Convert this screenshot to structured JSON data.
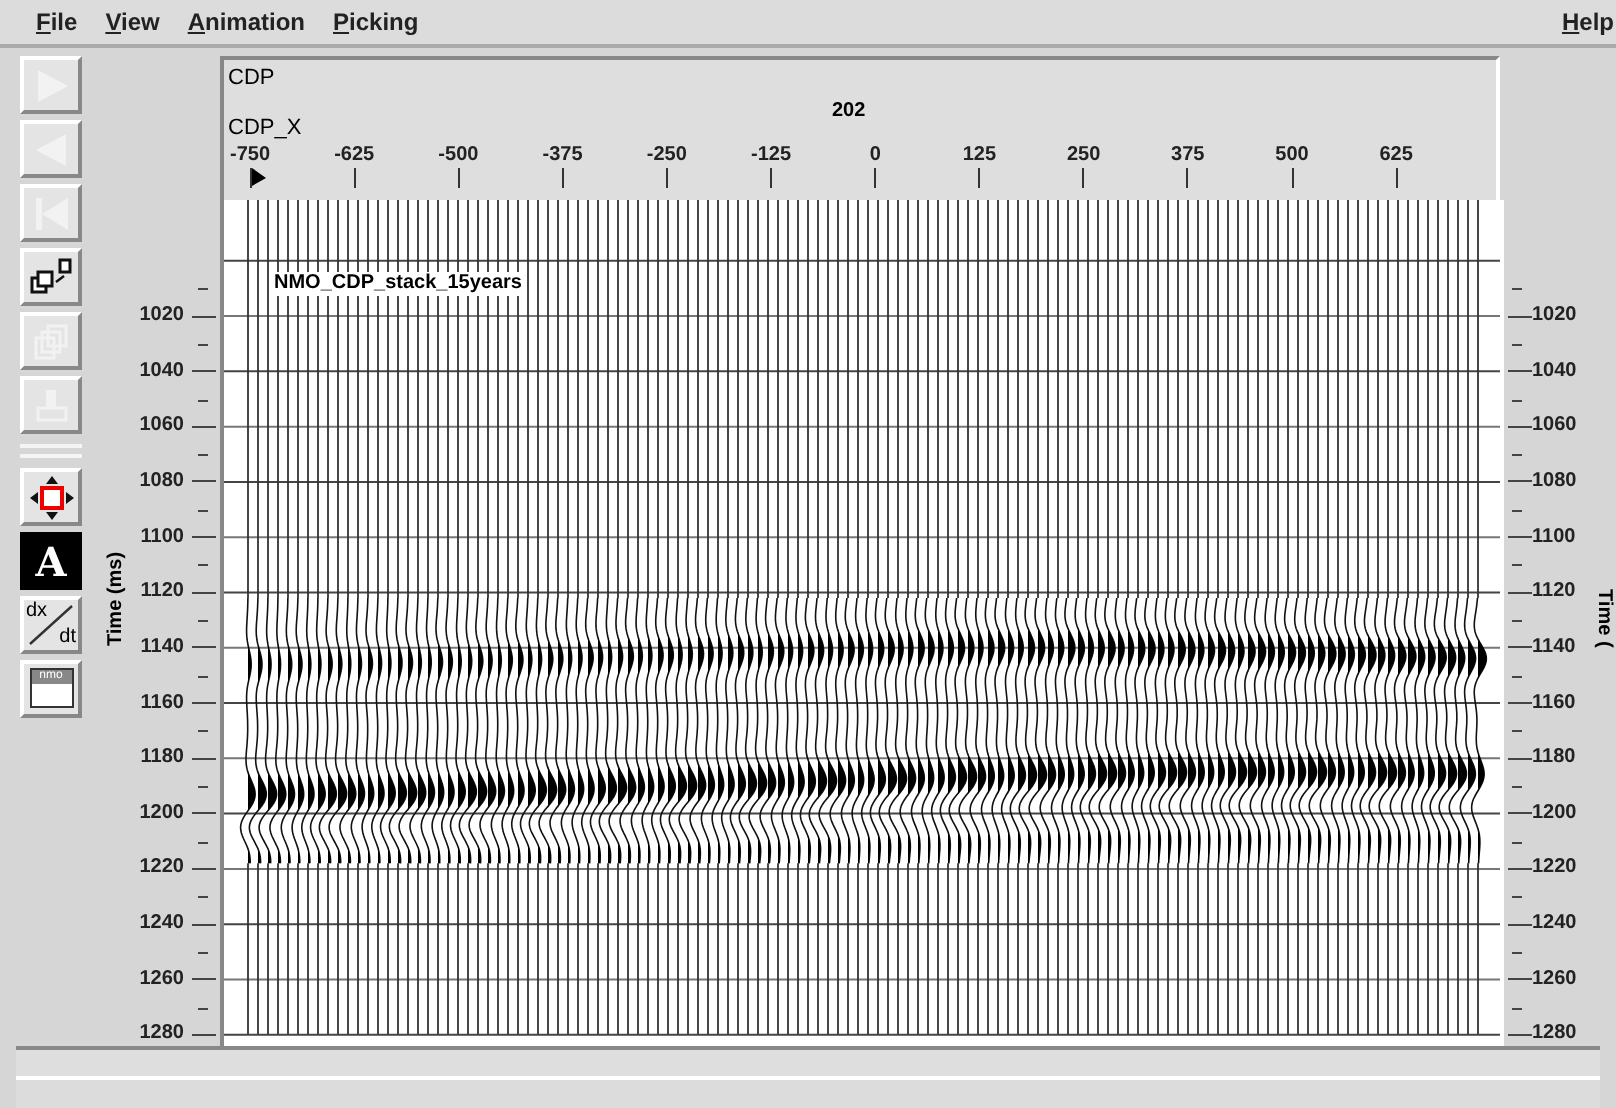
{
  "menu": [
    "File",
    "View",
    "Animation",
    "Picking"
  ],
  "help_menu": "Help",
  "toolbar": {
    "top": [
      {
        "kind": "forward",
        "disabled": true
      },
      {
        "kind": "backward",
        "disabled": true
      },
      {
        "kind": "rewind",
        "disabled": true
      },
      {
        "kind": "windows",
        "disabled": false
      },
      {
        "kind": "pages",
        "disabled": true
      },
      {
        "kind": "print",
        "disabled": true
      }
    ],
    "bottom": [
      {
        "kind": "pan",
        "selected": false
      },
      {
        "kind": "text",
        "label": "A",
        "selected": true
      },
      {
        "kind": "slope",
        "label_top": "dx",
        "label_bottom": "dt",
        "selected": false
      },
      {
        "kind": "window",
        "label": "nmo",
        "selected": false
      }
    ]
  },
  "header": {
    "key_label": "CDP",
    "axis_label": "CDP_X",
    "key_value": "202",
    "ticks": [
      "-750",
      "-625",
      "-500",
      "-375",
      "-250",
      "-125",
      "0",
      "125",
      "250",
      "375",
      "500",
      "625"
    ]
  },
  "plot_title": "NMO_CDP_stack_15years",
  "left_axis": {
    "label": "Time (ms)",
    "ticks": [
      "1020",
      "1040",
      "1060",
      "1080",
      "1100",
      "1120",
      "1140",
      "1160",
      "1180",
      "1200",
      "1220",
      "1240",
      "1260",
      "1280"
    ]
  },
  "right_axis": {
    "label": "Time (",
    "ticks": [
      "1020",
      "1040",
      "1060",
      "1080",
      "1100",
      "1120",
      "1140",
      "1160",
      "1180",
      "1200",
      "1220",
      "1240",
      "1260",
      "1280"
    ]
  }
}
